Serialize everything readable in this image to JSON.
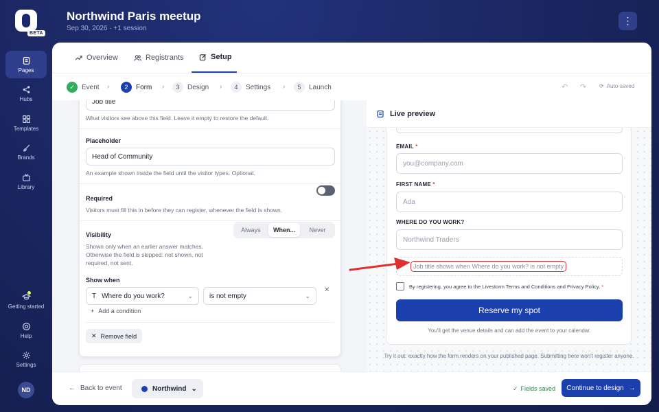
{
  "rail": {
    "beta": "BETA",
    "items": [
      {
        "label": "Pages"
      },
      {
        "label": "Hubs"
      },
      {
        "label": "Templates"
      },
      {
        "label": "Brands"
      },
      {
        "label": "Library"
      },
      {
        "label": "Getting started"
      },
      {
        "label": "Help"
      },
      {
        "label": "Settings"
      }
    ],
    "avatar": "ND"
  },
  "header": {
    "title": "Northwind Paris meetup",
    "subtitle": "Sep 30, 2026 · +1 session",
    "menu": "⋮"
  },
  "tabs": [
    {
      "label": "Overview"
    },
    {
      "label": "Registrants"
    },
    {
      "label": "Setup",
      "active": true
    }
  ],
  "steps": [
    {
      "num": "✓",
      "label": "Event"
    },
    {
      "num": "2",
      "label": "Form"
    },
    {
      "num": "3",
      "label": "Design"
    },
    {
      "num": "4",
      "label": "Settings"
    },
    {
      "num": "5",
      "label": "Launch"
    }
  ],
  "toolbar": {
    "undo": "↶",
    "redo": "↷",
    "autosaved": "Auto-saved"
  },
  "editor": {
    "label_value": "Job title",
    "label_help": "What visitors see above this field. Leave it empty to restore the default.",
    "placeholder_label": "Placeholder",
    "placeholder_value": "Head of Community",
    "placeholder_help": "An example shown inside the field until the visitor types. Optional.",
    "required_label": "Required",
    "required_help": "Visitors must fill this in before they can register, whenever the field is shown.",
    "visibility_label": "Visibility",
    "visibility_help_1": "Shown only when an earlier answer matches.",
    "visibility_help_2": "Otherwise the field is skipped: not shown, not",
    "visibility_help_3": "required, not sent.",
    "visibility_options": [
      "Always",
      "When...",
      "Never"
    ],
    "show_when_label": "Show when",
    "condition_field": "Where do you work?",
    "condition_field_icon": "T",
    "condition_operator": "is not empty",
    "add_condition": "Add a condition",
    "remove_field": "Remove field"
  },
  "preview": {
    "title": "Live preview",
    "email_label": "EMAIL",
    "email_placeholder": "you@company.com",
    "first_name_label": "FIRST NAME",
    "first_name_placeholder": "Ada",
    "work_label": "WHERE DO YOU WORK?",
    "work_placeholder": "Northwind Traders",
    "hidden_note": "Job title shows when Where do you work? is not empty",
    "terms": "By registering, you agree to the Livestorm Terms and Conditions and Privacy Policy.",
    "required_mark": "*",
    "button": "Reserve my spot",
    "after_note": "You'll get the venue details and can add the event to your calendar.",
    "footer_note": "Try it out: exactly how the form renders on your published page. Submitting here won't register anyone."
  },
  "footer": {
    "back": "Back to event",
    "brand": "Northwind",
    "saved": "Fields saved",
    "continue": "Continue to design"
  },
  "colors": {
    "primary": "#1c3fae",
    "rail_bg": "#1c2a6b",
    "success": "#2fae5f",
    "highlight": "#e03131"
  }
}
